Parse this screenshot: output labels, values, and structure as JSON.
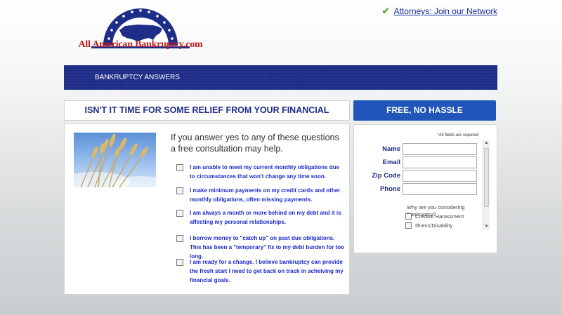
{
  "header": {
    "logo_text": "All American Bankruptcy.com",
    "attorneys_link": "Attorneys: Join our Network"
  },
  "nav": {
    "items": [
      "BANKRUPTCY ANSWERS"
    ]
  },
  "main": {
    "headline": "ISN'T IT TIME FOR SOME RELIEF FROM YOUR FINANCIAL WORRIES?",
    "intro": "If you answer yes to any of these questions a free consultation may help.",
    "questions": [
      "I am unable to meet my current monthly obligations due to circumstances that won't change any time soon.",
      "I make minimum payments on my credit cards and other monthly obligations, often missing payments.",
      "I am always a month or more behind on my debt and it is affecting my personal relationships.",
      "I borrow money to \"catch up\" on past due obligations. This has been a \"temporary\" fix to my debt burden for too long.",
      "I am ready for a change. I believe bankruptcy can provide the fresh start I need to get back on track in acheiving my financial goals."
    ]
  },
  "form": {
    "title": "FREE, NO HASSLE CONSULTATION",
    "required_note": "*All fields are required",
    "fields": [
      "Name",
      "Email",
      "Zip Code",
      "Phone"
    ],
    "why_question": "Why are you considering Bankruptcy?",
    "reasons": [
      "Creditor Harassment",
      "Illness/Disability"
    ]
  },
  "colors": {
    "nav_bg": "#1e2d88",
    "accent_blue": "#2155b9",
    "question_text": "#1a29c8",
    "logo_red": "#c41a1a"
  }
}
